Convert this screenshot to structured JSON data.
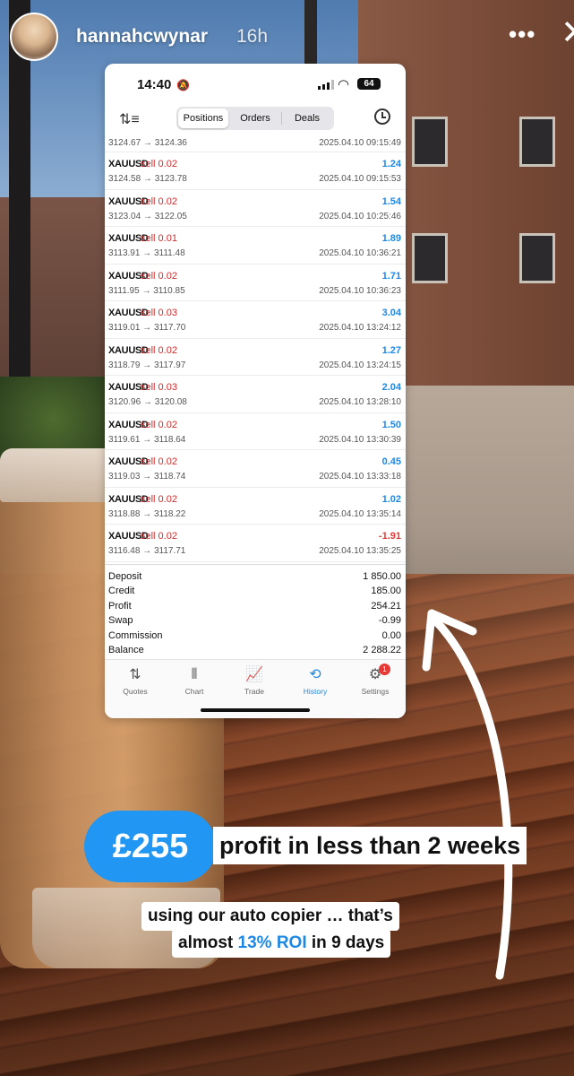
{
  "story": {
    "username": "hannahcwynar",
    "time_ago": "16h",
    "more": "•••",
    "close": "✕"
  },
  "phone": {
    "status": {
      "time": "14:40",
      "battery": "64"
    },
    "segments": [
      "Positions",
      "Orders",
      "Deals"
    ],
    "active_segment": "Positions",
    "partial_row": {
      "prices": "3124.67 → 3124.36",
      "time": "2025.04.10 09:15:49"
    },
    "trades": [
      {
        "symbol": "XAUUSD",
        "side": "sell 0.02",
        "profit": "1.24",
        "prices": "3124.58 → 3123.78",
        "time": "2025.04.10 09:15:53",
        "color": "#1e88e5"
      },
      {
        "symbol": "XAUUSD",
        "side": "sell 0.02",
        "profit": "1.54",
        "prices": "3123.04 → 3122.05",
        "time": "2025.04.10 10:25:46",
        "color": "#1e88e5"
      },
      {
        "symbol": "XAUUSD",
        "side": "sell 0.01",
        "profit": "1.89",
        "prices": "3113.91 → 3111.48",
        "time": "2025.04.10 10:36:21",
        "color": "#1e88e5"
      },
      {
        "symbol": "XAUUSD",
        "side": "sell 0.02",
        "profit": "1.71",
        "prices": "3111.95 → 3110.85",
        "time": "2025.04.10 10:36:23",
        "color": "#1e88e5"
      },
      {
        "symbol": "XAUUSD",
        "side": "sell 0.03",
        "profit": "3.04",
        "prices": "3119.01 → 3117.70",
        "time": "2025.04.10 13:24:12",
        "color": "#1e88e5"
      },
      {
        "symbol": "XAUUSD",
        "side": "sell 0.02",
        "profit": "1.27",
        "prices": "3118.79 → 3117.97",
        "time": "2025.04.10 13:24:15",
        "color": "#1e88e5"
      },
      {
        "symbol": "XAUUSD",
        "side": "sell 0.03",
        "profit": "2.04",
        "prices": "3120.96 → 3120.08",
        "time": "2025.04.10 13:28:10",
        "color": "#1e88e5"
      },
      {
        "symbol": "XAUUSD",
        "side": "sell 0.02",
        "profit": "1.50",
        "prices": "3119.61 → 3118.64",
        "time": "2025.04.10 13:30:39",
        "color": "#1e88e5"
      },
      {
        "symbol": "XAUUSD",
        "side": "sell 0.02",
        "profit": "0.45",
        "prices": "3119.03 → 3118.74",
        "time": "2025.04.10 13:33:18",
        "color": "#1e88e5"
      },
      {
        "symbol": "XAUUSD",
        "side": "sell 0.02",
        "profit": "1.02",
        "prices": "3118.88 → 3118.22",
        "time": "2025.04.10 13:35:14",
        "color": "#1e88e5"
      },
      {
        "symbol": "XAUUSD",
        "side": "sell 0.02",
        "profit": "-1.91",
        "prices": "3116.48 → 3117.71",
        "time": "2025.04.10 13:35:25",
        "color": "#e53935"
      }
    ],
    "summary": [
      {
        "label": "Deposit",
        "value": "1 850.00"
      },
      {
        "label": "Credit",
        "value": "185.00"
      },
      {
        "label": "Profit",
        "value": "254.21"
      },
      {
        "label": "Swap",
        "value": "-0.99"
      },
      {
        "label": "Commission",
        "value": "0.00"
      },
      {
        "label": "Balance",
        "value": "2 288.22"
      }
    ],
    "tabs": [
      {
        "label": "Quotes",
        "icon": "⇅"
      },
      {
        "label": "Chart",
        "icon": "⫴"
      },
      {
        "label": "Trade",
        "icon": "📈"
      },
      {
        "label": "History",
        "icon": "⟲"
      },
      {
        "label": "Settings",
        "icon": "⚙"
      }
    ],
    "active_tab": "History",
    "settings_badge": "1"
  },
  "overlay": {
    "amount": "£255",
    "caption_line1": "profit in less than 2 weeks",
    "caption_line2": "using our auto copier … that’s",
    "caption_line3_pre": "almost ",
    "caption_line3_roi": "13% ROI",
    "caption_line3_post": " in 9 days"
  },
  "colors": {
    "accent": "#2196f3",
    "loss": "#e53935",
    "side": "#d22b2b"
  }
}
